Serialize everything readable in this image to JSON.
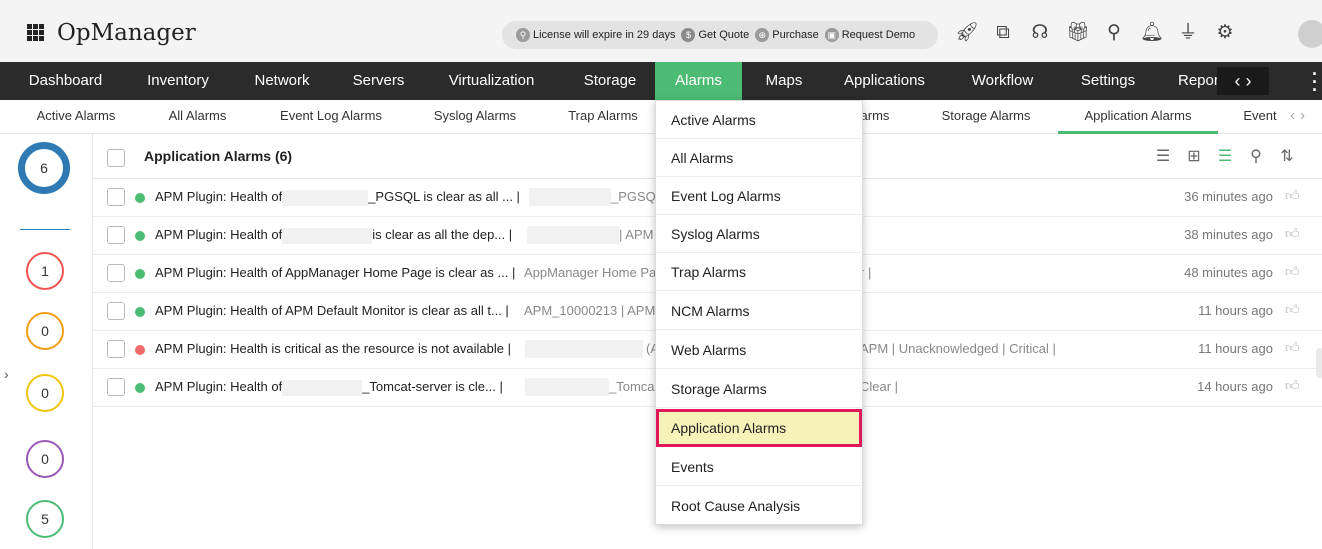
{
  "app": {
    "name": "OpManager"
  },
  "license": {
    "expire_text": "License will expire in 29 days",
    "get_quote": "Get Quote",
    "purchase": "Purchase",
    "request_demo": "Request Demo"
  },
  "top_icons": [
    "rocket-icon",
    "presentation-icon",
    "headset-icon",
    "gift-icon",
    "search-icon",
    "bell-icon",
    "plug-icon",
    "gear-icon",
    "user-avatar"
  ],
  "nav": {
    "items": [
      {
        "label": "Dashboard"
      },
      {
        "label": "Inventory"
      },
      {
        "label": "Network"
      },
      {
        "label": "Servers"
      },
      {
        "label": "Virtualization"
      },
      {
        "label": "Storage"
      },
      {
        "label": "Alarms",
        "active": true
      },
      {
        "label": "Maps"
      },
      {
        "label": "Applications"
      },
      {
        "label": "Workflow"
      },
      {
        "label": "Settings"
      },
      {
        "label": "Report"
      }
    ],
    "arrows": "‹ ›"
  },
  "subnav": {
    "items": [
      {
        "label": "Active Alarms"
      },
      {
        "label": "All Alarms"
      },
      {
        "label": "Event Log Alarms"
      },
      {
        "label": "Syslog Alarms"
      },
      {
        "label": "Trap Alarms"
      },
      {
        "label": "arms"
      },
      {
        "label": "Storage Alarms"
      },
      {
        "label": "Application Alarms",
        "active": true
      },
      {
        "label": "Event"
      }
    ]
  },
  "severity_panel": {
    "total": "6",
    "counts": [
      "1",
      "0",
      "0",
      "0",
      "5"
    ],
    "colors": [
      "#2f79b5",
      "#ef5350",
      "#f39c12",
      "#f1c40f",
      "#9b59b6",
      "#4cbc74"
    ]
  },
  "table": {
    "title": "Application Alarms (6)",
    "rows": [
      {
        "severity_color": "#4cbc74",
        "msg_a": "APM Plugin: Health of",
        "msg_b": "_PGSQL is clear as all ... |",
        "src": "_PGSQ",
        "tail": "",
        "time": "36 minutes ago"
      },
      {
        "severity_color": "#4cbc74",
        "msg_a": "APM Plugin: Health of",
        "msg_b": "is clear as all the dep... |",
        "src": "| APM",
        "tail": "",
        "time": "38 minutes ago"
      },
      {
        "severity_color": "#4cbc74",
        "msg_a": "APM Plugin: Health of AppManager Home Page is clear as ... |",
        "msg_b": "",
        "src": "AppManager Home Pa",
        "tail": "r |",
        "time": "48 minutes ago"
      },
      {
        "severity_color": "#4cbc74",
        "msg_a": "APM Plugin: Health of APM Default Monitor is clear as all t... |",
        "msg_b": "",
        "src": "APM_10000213 | APM",
        "tail": "",
        "time": "11 hours ago"
      },
      {
        "severity_color": "#ef6b6b",
        "msg_a": "APM Plugin: Health is critical as the resource is not available |",
        "msg_b": "",
        "src": "(A",
        "tail": "APM | Unacknowledged | Critical |",
        "time": "11 hours ago"
      },
      {
        "severity_color": "#4cbc74",
        "msg_a": "APM Plugin: Health of",
        "msg_b": "_Tomcat-server is cle... |",
        "src": "_Tomca",
        "tail": "Clear |",
        "time": "14 hours ago"
      }
    ]
  },
  "dropdown": {
    "items": [
      {
        "label": "Active Alarms"
      },
      {
        "label": "All Alarms"
      },
      {
        "label": "Event Log Alarms"
      },
      {
        "label": "Syslog Alarms"
      },
      {
        "label": "Trap Alarms"
      },
      {
        "label": "NCM Alarms"
      },
      {
        "label": "Web Alarms"
      },
      {
        "label": "Storage Alarms"
      },
      {
        "label": "Application Alarms",
        "highlighted": true
      },
      {
        "label": "Events"
      },
      {
        "label": "Root Cause Analysis"
      }
    ]
  }
}
